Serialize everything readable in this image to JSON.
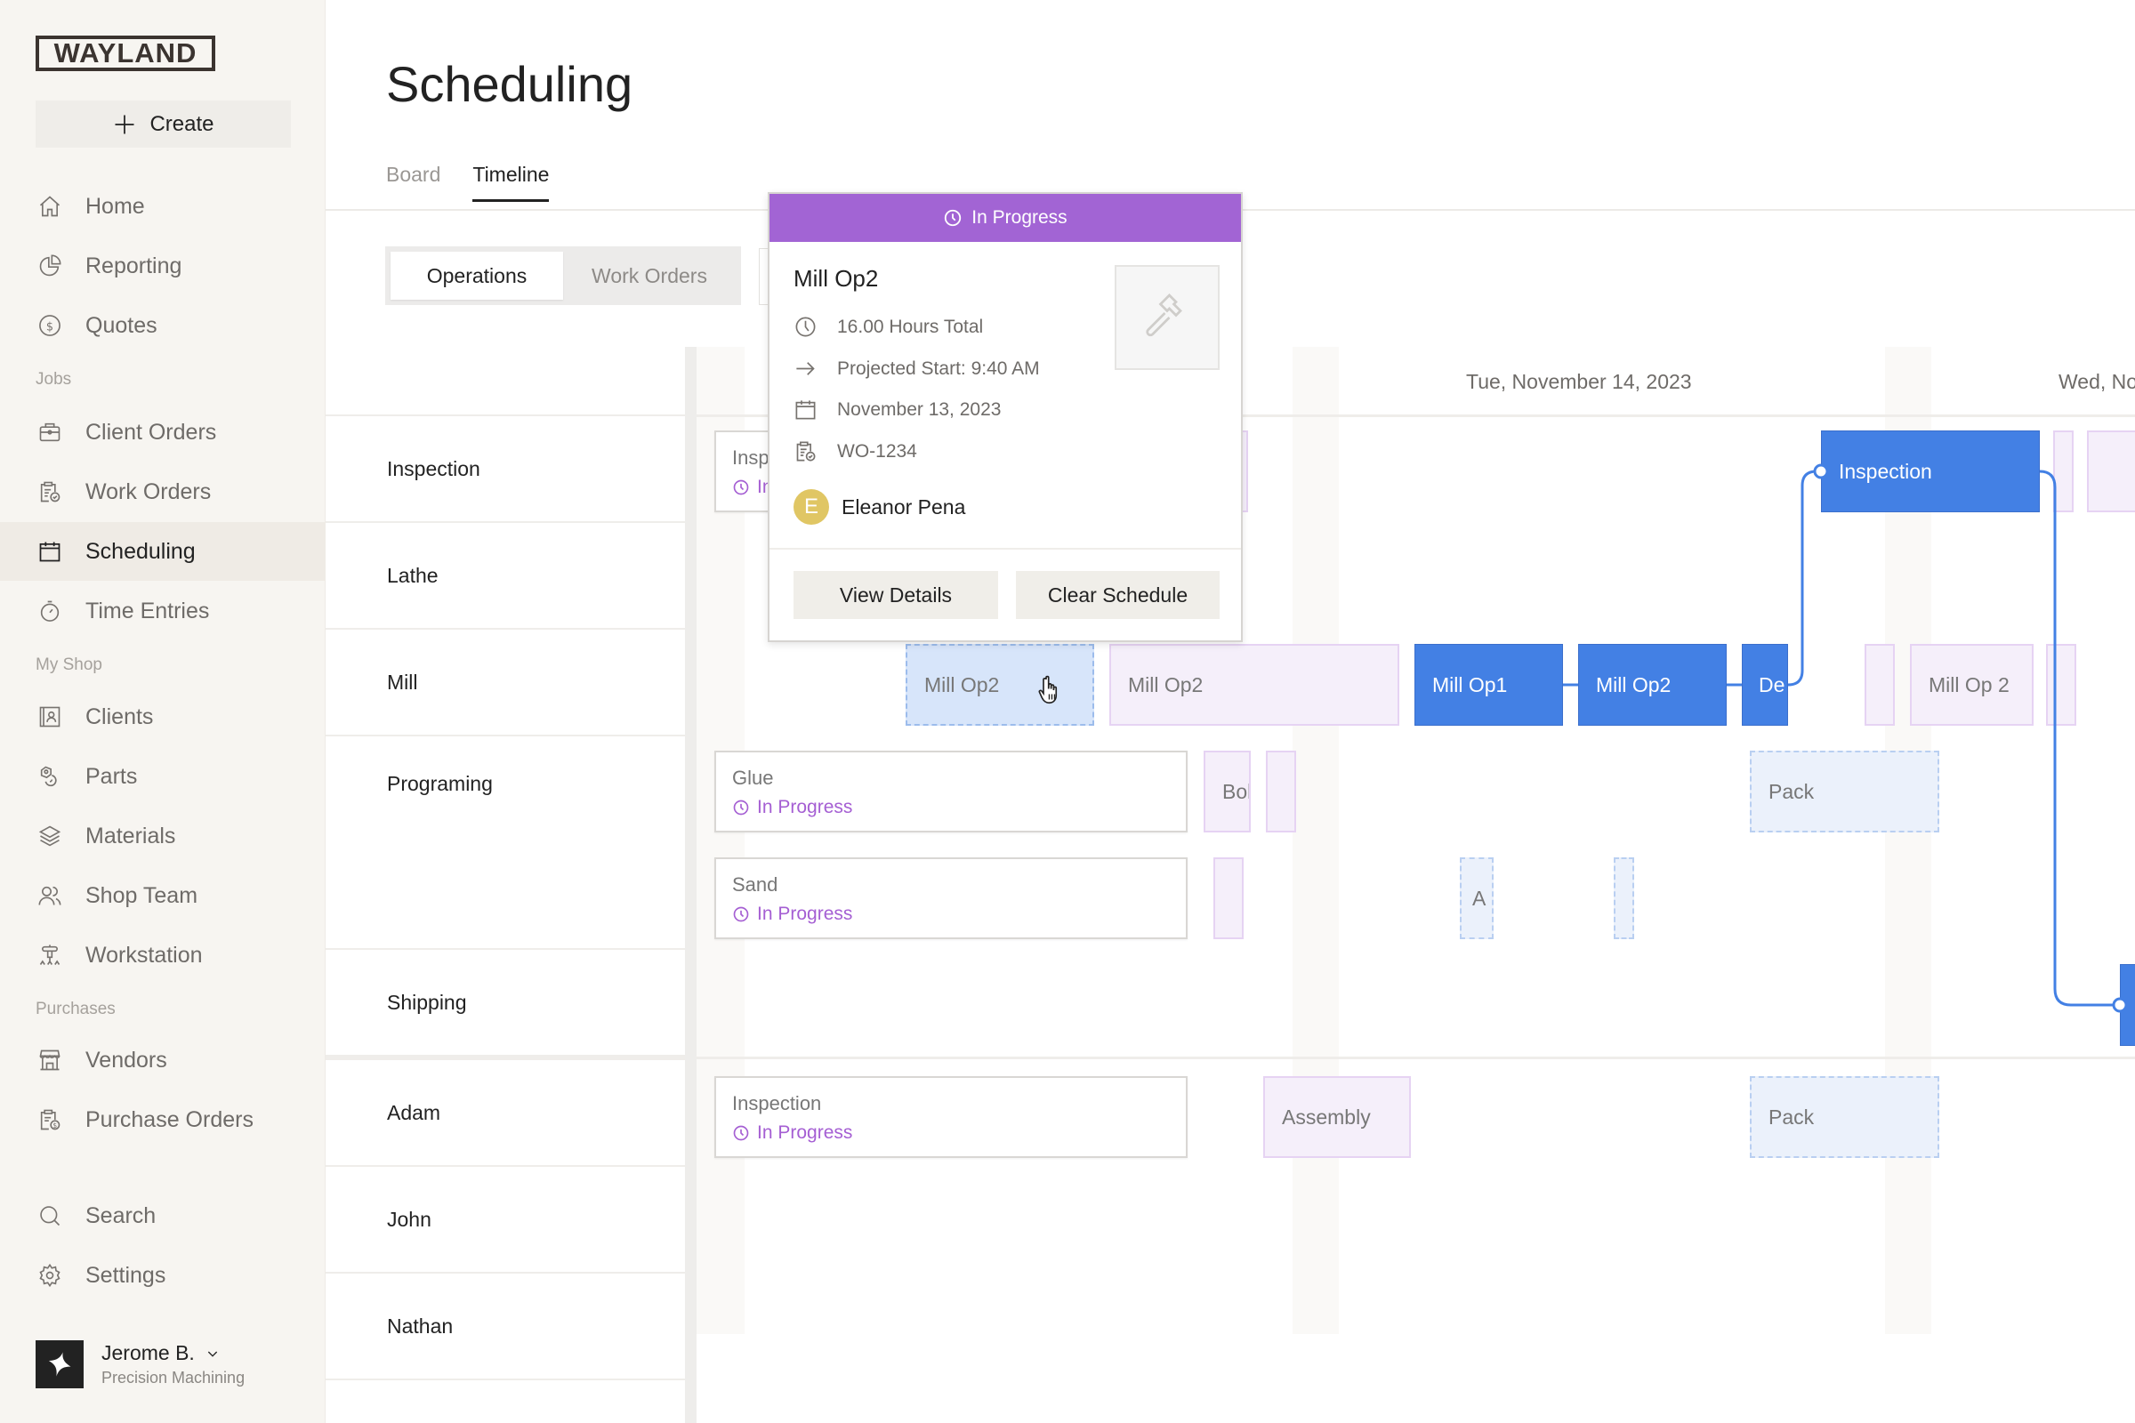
{
  "sidebar": {
    "logo": "WAYLAND",
    "create_label": "Create",
    "items_top": [
      {
        "label": "Home",
        "icon": "home-icon"
      },
      {
        "label": "Reporting",
        "icon": "pie-chart-icon"
      },
      {
        "label": "Quotes",
        "icon": "dollar-circle-icon"
      }
    ],
    "section_jobs": "Jobs",
    "items_jobs": [
      {
        "label": "Client Orders",
        "icon": "briefcase-icon"
      },
      {
        "label": "Work Orders",
        "icon": "clipboard-check-icon"
      },
      {
        "label": "Scheduling",
        "icon": "calendar-icon",
        "active": true
      },
      {
        "label": "Time Entries",
        "icon": "stopwatch-icon"
      }
    ],
    "section_shop": "My Shop",
    "items_shop": [
      {
        "label": "Clients",
        "icon": "contact-book-icon"
      },
      {
        "label": "Parts",
        "icon": "parts-icon"
      },
      {
        "label": "Materials",
        "icon": "layers-icon"
      },
      {
        "label": "Shop Team",
        "icon": "users-icon"
      },
      {
        "label": "Workstation",
        "icon": "workstation-icon"
      }
    ],
    "section_purchases": "Purchases",
    "items_purchases": [
      {
        "label": "Vendors",
        "icon": "storefront-icon"
      },
      {
        "label": "Purchase Orders",
        "icon": "clipboard-dollar-icon"
      }
    ],
    "items_bottom": [
      {
        "label": "Search",
        "icon": "search-icon"
      },
      {
        "label": "Settings",
        "icon": "gear-icon"
      }
    ],
    "user": {
      "name": "Jerome B.",
      "org": "Precision Machining"
    }
  },
  "header": {
    "title": "Scheduling",
    "tabs": [
      {
        "label": "Board",
        "active": false
      },
      {
        "label": "Timeline",
        "active": true
      }
    ],
    "view_toggle": [
      {
        "label": "Operations",
        "active": true
      },
      {
        "label": "Work Orders",
        "active": false
      }
    ]
  },
  "timeline": {
    "dates": [
      "Tue, November 14, 2023",
      "Wed, Nov"
    ],
    "rows": [
      {
        "label": "Inspection"
      },
      {
        "label": "Lathe"
      },
      {
        "label": "Mill"
      },
      {
        "label": "Programing"
      },
      {
        "label": "Shipping"
      },
      {
        "label": "Adam"
      },
      {
        "label": "John"
      },
      {
        "label": "Nathan"
      }
    ],
    "cards": [
      {
        "title": "Insp",
        "status": "In Progress"
      },
      {
        "title": "Glue",
        "status": "In Progress"
      },
      {
        "title": "Sand",
        "status": "In Progress"
      },
      {
        "title": "Inspection",
        "status": "In Progress"
      }
    ],
    "blocks": {
      "mill_hovered": "Mill Op2",
      "mill_purple_1": "Mill Op2",
      "mill_op1": "Mill Op1",
      "mill_op2": "Mill Op2",
      "mill_de": "De",
      "mill_purple_2": "Mill Op 2",
      "inspection_blue": "Inspection",
      "prog_bol": "Bol",
      "prog_pack": "Pack",
      "sand_a": "A",
      "adam_assembly": "Assembly",
      "adam_pack": "Pack"
    },
    "status_color": "#a264d4",
    "scheduled_color": "#4380e4"
  },
  "popover": {
    "status": "In Progress",
    "title": "Mill Op2",
    "hours": "16.00 Hours Total",
    "projected_start": "Projected Start: 9:40 AM",
    "date": "November 13, 2023",
    "work_order": "WO-1234",
    "assignee_initial": "E",
    "assignee": "Eleanor Pena",
    "view_details": "View Details",
    "clear_schedule": "Clear Schedule"
  }
}
